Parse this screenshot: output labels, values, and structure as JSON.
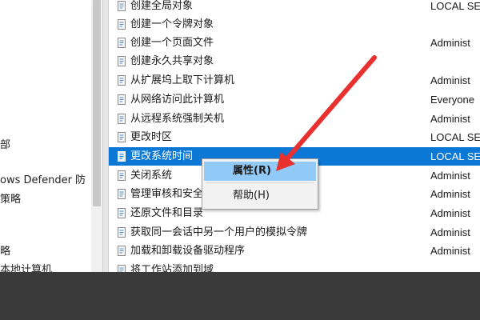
{
  "left_pane": {
    "items": [
      "部",
      "ows Defender 防",
      "策略",
      "略",
      "本地计算机"
    ]
  },
  "policies": [
    {
      "name": "创建全局对象",
      "setting": "LOCAL SE"
    },
    {
      "name": "创建一个令牌对象",
      "setting": ""
    },
    {
      "name": "创建一个页面文件",
      "setting": "Administ"
    },
    {
      "name": "创建永久共享对象",
      "setting": ""
    },
    {
      "name": "从扩展坞上取下计算机",
      "setting": "Administ"
    },
    {
      "name": "从网络访问此计算机",
      "setting": "Everyone"
    },
    {
      "name": "从远程系统强制关机",
      "setting": "Administ"
    },
    {
      "name": "更改时区",
      "setting": "LOCAL SE"
    },
    {
      "name": "更改系统时间",
      "setting": "LOCAL SE",
      "selected": true
    },
    {
      "name": "关闭系统",
      "setting": "Administ"
    },
    {
      "name": "管理审核和安全",
      "setting": "Administ"
    },
    {
      "name": "还原文件和目录",
      "setting": "Administ"
    },
    {
      "name": "获取同一会话中另一个用户的模拟令牌",
      "setting": "Administ"
    },
    {
      "name": "加载和卸载设备驱动程序",
      "setting": "Administ"
    },
    {
      "name": "将工作站添加到域",
      "setting": ""
    }
  ],
  "context_menu": {
    "properties_label": "属性(R)",
    "help_label": "帮助(H)"
  },
  "colors": {
    "selection": "#0c78d6",
    "menu_hover": "#91c9f7",
    "arrow": "#e8312f"
  },
  "icons": {
    "policy": "policy-icon"
  }
}
